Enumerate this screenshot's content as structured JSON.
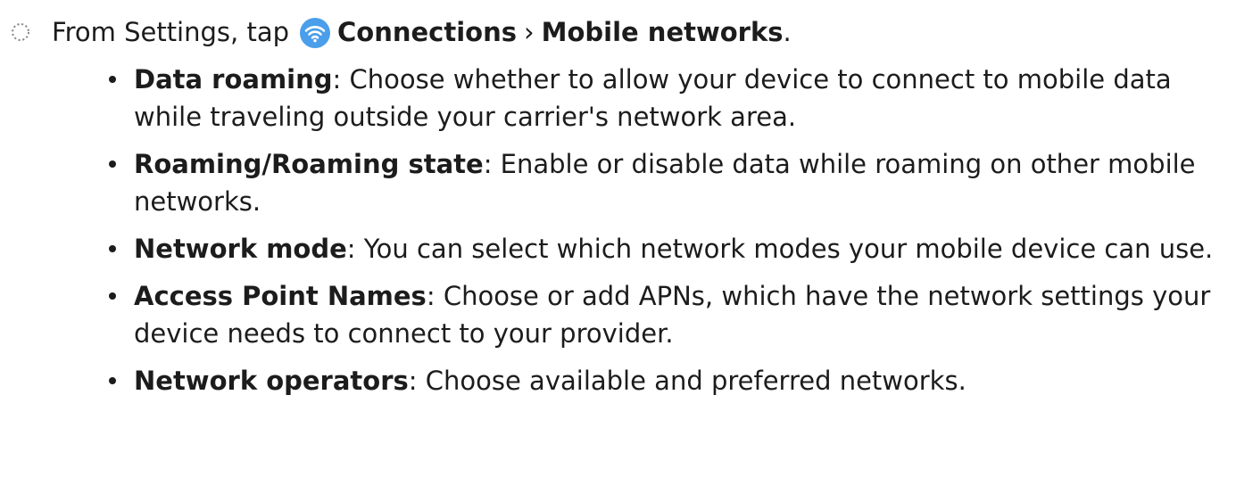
{
  "step": {
    "bullet_icon": "dotted-circle-icon",
    "prefix": "From Settings, tap",
    "icon": "wifi-connections-icon",
    "icon_color": "#4a9eea",
    "location_primary": "Connections",
    "separator": "›",
    "location_secondary": "Mobile networks",
    "suffix": "."
  },
  "items": [
    {
      "term": "Data roaming",
      "text": ": Choose whether to allow your device to connect to mobile data while traveling outside your carrier's network area."
    },
    {
      "term": "Roaming/Roaming state",
      "text": ": Enable or disable data while roaming on other mobile networks."
    },
    {
      "term": "Network mode",
      "text": ": You can select which network modes your mobile device can use."
    },
    {
      "term": "Access Point Names",
      "text": ": Choose or add APNs, which have the network settings your device needs to connect to your provider."
    },
    {
      "term": "Network operators",
      "text": ": Choose available and preferred networks."
    }
  ]
}
